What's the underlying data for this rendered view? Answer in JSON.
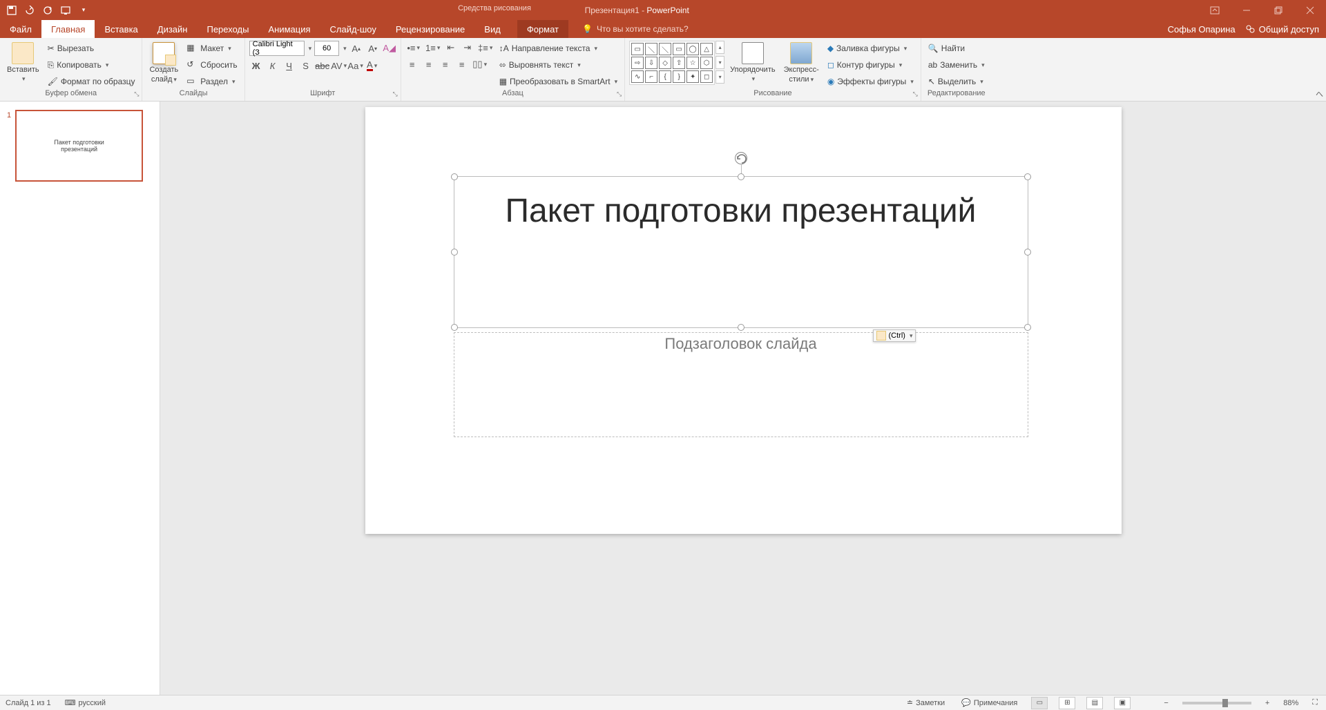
{
  "titlebar": {
    "doc_title": "Презентация1",
    "app_name": "PowerPoint",
    "context_tool": "Средства рисования"
  },
  "tabs": {
    "file": "Файл",
    "home": "Главная",
    "insert": "Вставка",
    "design": "Дизайн",
    "transitions": "Переходы",
    "animations": "Анимация",
    "slideshow": "Слайд-шоу",
    "review": "Рецензирование",
    "view": "Вид",
    "format": "Формат",
    "tell_me": "Что вы хотите сделать?"
  },
  "tabrow_right": {
    "user": "Софья Опарина",
    "share": "Общий доступ"
  },
  "ribbon": {
    "clipboard": {
      "paste": "Вставить",
      "cut": "Вырезать",
      "copy": "Копировать",
      "format_painter": "Формат по образцу",
      "label": "Буфер обмена"
    },
    "slides": {
      "new_slide_l1": "Создать",
      "new_slide_l2": "слайд",
      "layout": "Макет",
      "reset": "Сбросить",
      "section": "Раздел",
      "label": "Слайды"
    },
    "font": {
      "name": "Calibri Light (З",
      "size": "60",
      "label": "Шрифт"
    },
    "paragraph": {
      "text_direction": "Направление текста",
      "align_text": "Выровнять текст",
      "convert_smartart": "Преобразовать в SmartArt",
      "label": "Абзац"
    },
    "drawing": {
      "arrange": "Упорядочить",
      "quick_styles_l1": "Экспресс-",
      "quick_styles_l2": "стили",
      "shape_fill": "Заливка фигуры",
      "shape_outline": "Контур фигуры",
      "shape_effects": "Эффекты фигуры",
      "label": "Рисование"
    },
    "editing": {
      "find": "Найти",
      "replace": "Заменить",
      "select": "Выделить",
      "label": "Редактирование"
    }
  },
  "thumbnail": {
    "num": "1",
    "line1": "Пакет подготовки",
    "line2": "презентаций"
  },
  "slide": {
    "title": "Пакет подготовки презентаций",
    "subtitle_placeholder": "Подзаголовок слайда",
    "paste_opts": "(Ctrl)"
  },
  "status": {
    "slide_of": "Слайд 1 из 1",
    "language": "русский",
    "notes": "Заметки",
    "comments": "Примечания",
    "zoom": "88%"
  }
}
